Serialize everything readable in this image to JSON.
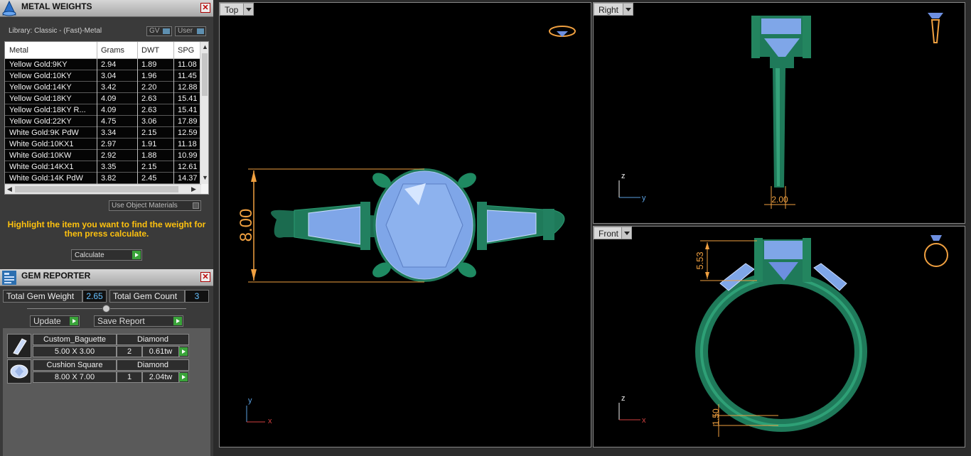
{
  "metal_weights": {
    "title": "METAL WEIGHTS",
    "library_label": "Library: Classic - (Fast)-Metal",
    "toggle_gv": "GV",
    "toggle_user": "User",
    "columns": [
      "Metal",
      "Grams",
      "DWT",
      "SPG"
    ],
    "rows": [
      {
        "metal": "Yellow Gold:9KY",
        "grams": "2.94",
        "dwt": "1.89",
        "spg": "11.08"
      },
      {
        "metal": "Yellow Gold:10KY",
        "grams": "3.04",
        "dwt": "1.96",
        "spg": "11.45"
      },
      {
        "metal": "Yellow Gold:14KY",
        "grams": "3.42",
        "dwt": "2.20",
        "spg": "12.88"
      },
      {
        "metal": "Yellow Gold:18KY",
        "grams": "4.09",
        "dwt": "2.63",
        "spg": "15.41"
      },
      {
        "metal": "Yellow Gold:18KY R...",
        "grams": "4.09",
        "dwt": "2.63",
        "spg": "15.41"
      },
      {
        "metal": "Yellow Gold:22KY",
        "grams": "4.75",
        "dwt": "3.06",
        "spg": "17.89"
      },
      {
        "metal": "White Gold:9K PdW",
        "grams": "3.34",
        "dwt": "2.15",
        "spg": "12.59"
      },
      {
        "metal": "White Gold:10KX1",
        "grams": "2.97",
        "dwt": "1.91",
        "spg": "11.18"
      },
      {
        "metal": "White Gold:10KW",
        "grams": "2.92",
        "dwt": "1.88",
        "spg": "10.99"
      },
      {
        "metal": "White Gold:14KX1",
        "grams": "3.35",
        "dwt": "2.15",
        "spg": "12.61"
      },
      {
        "metal": "White Gold:14K PdW",
        "grams": "3.82",
        "dwt": "2.45",
        "spg": "14.37"
      }
    ],
    "use_object_materials": "Use Object Materials",
    "hint": "Highlight the item you want to find the weight for then press calculate.",
    "calculate_label": "Calculate"
  },
  "gem_reporter": {
    "title": "GEM REPORTER",
    "total_weight_label": "Total Gem Weight",
    "total_weight_value": "2.65",
    "total_count_label": "Total Gem Count",
    "total_count_value": "3",
    "update_label": "Update",
    "save_report_label": "Save Report",
    "gems": [
      {
        "shape": "Custom_Baguette",
        "material": "Diamond",
        "size": "5.00 X 3.00",
        "count": "2",
        "weight": "0.61tw"
      },
      {
        "shape": "Cushion Square",
        "material": "Diamond",
        "size": "8.00 X 7.00",
        "count": "1",
        "weight": "2.04tw"
      }
    ]
  },
  "viewports": {
    "top": {
      "label": "Top",
      "dimension": "8.00",
      "axis_y": "y",
      "axis_x": "x"
    },
    "right": {
      "label": "Right",
      "dimension": "2.00",
      "axis_z": "z",
      "axis_y": "y"
    },
    "front": {
      "label": "Front",
      "dimension_height": "5.53",
      "dimension_shank": "1.50",
      "axis_z": "z",
      "axis_x": "x"
    }
  },
  "colors": {
    "metal_green": "#1f7a5a",
    "gem_blue": "#7fa6e8",
    "dimension_orange": "#f0a040",
    "hint_yellow": "#ffc20e"
  }
}
